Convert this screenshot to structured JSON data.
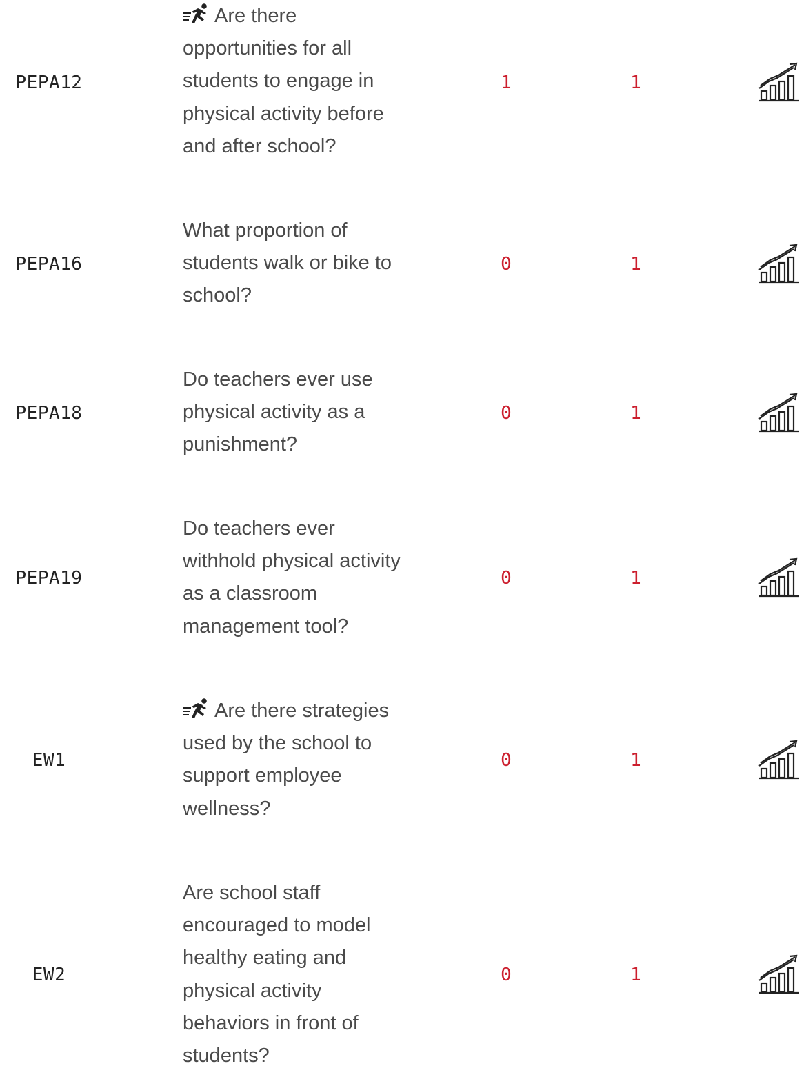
{
  "rows": [
    {
      "code": "PEPA12",
      "question": "Are there opportunities for all students to engage in physical activity before and after school?",
      "has_activity_icon": true,
      "score_a": "1",
      "score_b": "1",
      "trend_icon": "trend-chart-icon"
    },
    {
      "code": "PEPA16",
      "question": "What proportion of students walk or bike to school?",
      "has_activity_icon": false,
      "score_a": "0",
      "score_b": "1",
      "trend_icon": "trend-chart-icon"
    },
    {
      "code": "PEPA18",
      "question": "Do teachers ever use physical activity as a punishment?",
      "has_activity_icon": false,
      "score_a": "0",
      "score_b": "1",
      "trend_icon": "trend-chart-icon"
    },
    {
      "code": "PEPA19",
      "question": "Do teachers ever withhold physical activity as a classroom management tool?",
      "has_activity_icon": false,
      "score_a": "0",
      "score_b": "1",
      "trend_icon": "trend-chart-icon"
    },
    {
      "code": "EW1",
      "question": "Are there strategies used by the school to support employee wellness?",
      "has_activity_icon": true,
      "score_a": "0",
      "score_b": "1",
      "trend_icon": "trend-chart-icon"
    },
    {
      "code": "EW2",
      "question": "Are school staff encouraged to model healthy eating and physical activity behaviors in front of students?",
      "has_activity_icon": false,
      "score_a": "0",
      "score_b": "1",
      "trend_icon": "trend-chart-icon"
    }
  ],
  "icons": {
    "activity": "running-person-icon",
    "trend": "trend-chart-icon"
  },
  "colors": {
    "code_text": "#222222",
    "question_text": "#4a4a4a",
    "score_text": "#cc1f2e",
    "background": "#ffffff"
  }
}
